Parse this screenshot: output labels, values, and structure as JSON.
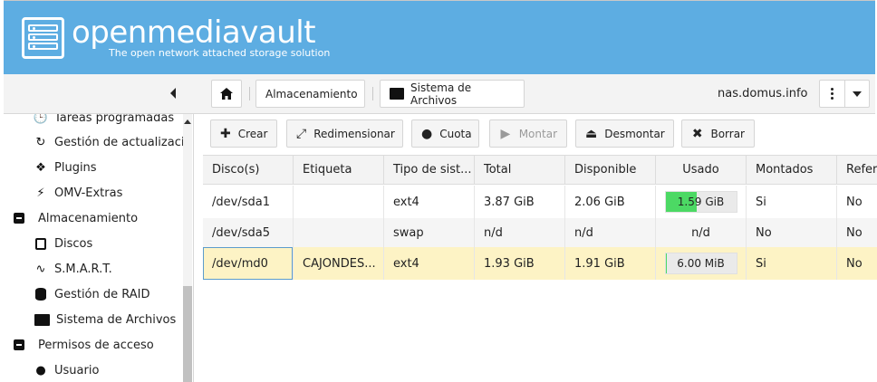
{
  "header": {
    "brand": "openmediavault",
    "tagline": "The open network attached storage solution"
  },
  "topbar": {
    "crumbs": [
      "Almacenamiento",
      "Sistema de Archivos"
    ],
    "hostname": "nas.domus.info"
  },
  "sidebar": {
    "items": [
      {
        "label": "Tareas programadas",
        "icon": "clock-icon"
      },
      {
        "label": "Gestión de actualizacio",
        "icon": "refresh-icon"
      },
      {
        "label": "Plugins",
        "icon": "puzzle-icon"
      },
      {
        "label": "OMV-Extras",
        "icon": "plug-icon"
      },
      {
        "label": "Almacenamiento",
        "icon": "minus-square-icon"
      },
      {
        "label": "Discos",
        "icon": "disk-icon"
      },
      {
        "label": "S.M.A.R.T.",
        "icon": "heartbeat-icon"
      },
      {
        "label": "Gestión de RAID",
        "icon": "database-icon"
      },
      {
        "label": "Sistema de Archivos",
        "icon": "folder-icon"
      },
      {
        "label": "Permisos de acceso",
        "icon": "minus-square-icon"
      },
      {
        "label": "Usuario",
        "icon": "user-icon"
      }
    ]
  },
  "actions": {
    "create": "Crear",
    "resize": "Redimensionar",
    "quota": "Cuota",
    "mount": "Montar",
    "unmount": "Desmontar",
    "delete": "Borrar"
  },
  "table": {
    "columns": [
      "Disco(s)",
      "Etiqueta",
      "Tipo de sist...",
      "Total",
      "Disponible",
      "Usado",
      "Montados",
      "Refer"
    ],
    "rows": [
      {
        "disk": "/dev/sda1",
        "label": "",
        "type": "ext4",
        "total": "3.87 GiB",
        "available": "2.06 GiB",
        "used": "1.59 GiB",
        "used_fraction": 0.44,
        "mounted": "Si",
        "ref": "No"
      },
      {
        "disk": "/dev/sda5",
        "label": "",
        "type": "swap",
        "total": "n/d",
        "available": "n/d",
        "used": "n/d",
        "used_fraction": null,
        "mounted": "No",
        "ref": "No"
      },
      {
        "disk": "/dev/md0",
        "label": "CAJONDES...",
        "type": "ext4",
        "total": "1.93 GiB",
        "available": "1.91 GiB",
        "used": "6.00 MiB",
        "used_fraction": 0.01,
        "mounted": "Si",
        "ref": "No"
      }
    ]
  },
  "colors": {
    "header_bg": "#5dade2",
    "usage_fill": "#4cd964",
    "selected_row": "#fdf3c5"
  }
}
